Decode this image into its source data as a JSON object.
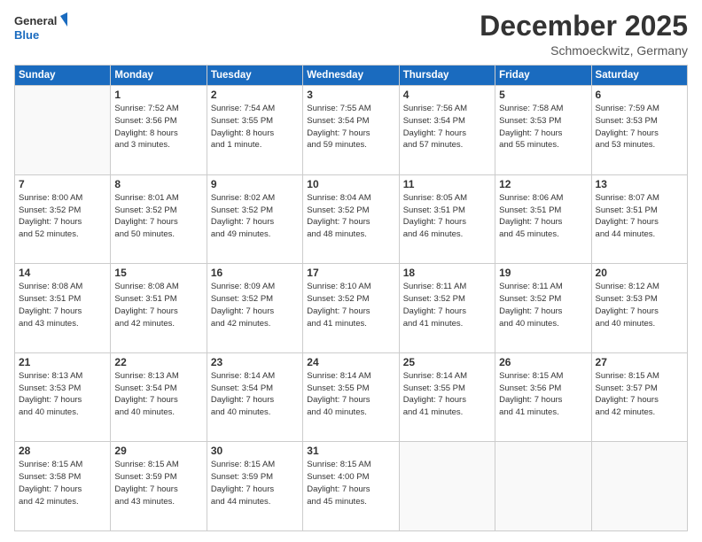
{
  "logo": {
    "line1": "General",
    "line2": "Blue"
  },
  "title": "December 2025",
  "location": "Schmoeckwitz, Germany",
  "days_of_week": [
    "Sunday",
    "Monday",
    "Tuesday",
    "Wednesday",
    "Thursday",
    "Friday",
    "Saturday"
  ],
  "weeks": [
    [
      {
        "day": "",
        "info": ""
      },
      {
        "day": "1",
        "info": "Sunrise: 7:52 AM\nSunset: 3:56 PM\nDaylight: 8 hours\nand 3 minutes."
      },
      {
        "day": "2",
        "info": "Sunrise: 7:54 AM\nSunset: 3:55 PM\nDaylight: 8 hours\nand 1 minute."
      },
      {
        "day": "3",
        "info": "Sunrise: 7:55 AM\nSunset: 3:54 PM\nDaylight: 7 hours\nand 59 minutes."
      },
      {
        "day": "4",
        "info": "Sunrise: 7:56 AM\nSunset: 3:54 PM\nDaylight: 7 hours\nand 57 minutes."
      },
      {
        "day": "5",
        "info": "Sunrise: 7:58 AM\nSunset: 3:53 PM\nDaylight: 7 hours\nand 55 minutes."
      },
      {
        "day": "6",
        "info": "Sunrise: 7:59 AM\nSunset: 3:53 PM\nDaylight: 7 hours\nand 53 minutes."
      }
    ],
    [
      {
        "day": "7",
        "info": "Sunrise: 8:00 AM\nSunset: 3:52 PM\nDaylight: 7 hours\nand 52 minutes."
      },
      {
        "day": "8",
        "info": "Sunrise: 8:01 AM\nSunset: 3:52 PM\nDaylight: 7 hours\nand 50 minutes."
      },
      {
        "day": "9",
        "info": "Sunrise: 8:02 AM\nSunset: 3:52 PM\nDaylight: 7 hours\nand 49 minutes."
      },
      {
        "day": "10",
        "info": "Sunrise: 8:04 AM\nSunset: 3:52 PM\nDaylight: 7 hours\nand 48 minutes."
      },
      {
        "day": "11",
        "info": "Sunrise: 8:05 AM\nSunset: 3:51 PM\nDaylight: 7 hours\nand 46 minutes."
      },
      {
        "day": "12",
        "info": "Sunrise: 8:06 AM\nSunset: 3:51 PM\nDaylight: 7 hours\nand 45 minutes."
      },
      {
        "day": "13",
        "info": "Sunrise: 8:07 AM\nSunset: 3:51 PM\nDaylight: 7 hours\nand 44 minutes."
      }
    ],
    [
      {
        "day": "14",
        "info": "Sunrise: 8:08 AM\nSunset: 3:51 PM\nDaylight: 7 hours\nand 43 minutes."
      },
      {
        "day": "15",
        "info": "Sunrise: 8:08 AM\nSunset: 3:51 PM\nDaylight: 7 hours\nand 42 minutes."
      },
      {
        "day": "16",
        "info": "Sunrise: 8:09 AM\nSunset: 3:52 PM\nDaylight: 7 hours\nand 42 minutes."
      },
      {
        "day": "17",
        "info": "Sunrise: 8:10 AM\nSunset: 3:52 PM\nDaylight: 7 hours\nand 41 minutes."
      },
      {
        "day": "18",
        "info": "Sunrise: 8:11 AM\nSunset: 3:52 PM\nDaylight: 7 hours\nand 41 minutes."
      },
      {
        "day": "19",
        "info": "Sunrise: 8:11 AM\nSunset: 3:52 PM\nDaylight: 7 hours\nand 40 minutes."
      },
      {
        "day": "20",
        "info": "Sunrise: 8:12 AM\nSunset: 3:53 PM\nDaylight: 7 hours\nand 40 minutes."
      }
    ],
    [
      {
        "day": "21",
        "info": "Sunrise: 8:13 AM\nSunset: 3:53 PM\nDaylight: 7 hours\nand 40 minutes."
      },
      {
        "day": "22",
        "info": "Sunrise: 8:13 AM\nSunset: 3:54 PM\nDaylight: 7 hours\nand 40 minutes."
      },
      {
        "day": "23",
        "info": "Sunrise: 8:14 AM\nSunset: 3:54 PM\nDaylight: 7 hours\nand 40 minutes."
      },
      {
        "day": "24",
        "info": "Sunrise: 8:14 AM\nSunset: 3:55 PM\nDaylight: 7 hours\nand 40 minutes."
      },
      {
        "day": "25",
        "info": "Sunrise: 8:14 AM\nSunset: 3:55 PM\nDaylight: 7 hours\nand 41 minutes."
      },
      {
        "day": "26",
        "info": "Sunrise: 8:15 AM\nSunset: 3:56 PM\nDaylight: 7 hours\nand 41 minutes."
      },
      {
        "day": "27",
        "info": "Sunrise: 8:15 AM\nSunset: 3:57 PM\nDaylight: 7 hours\nand 42 minutes."
      }
    ],
    [
      {
        "day": "28",
        "info": "Sunrise: 8:15 AM\nSunset: 3:58 PM\nDaylight: 7 hours\nand 42 minutes."
      },
      {
        "day": "29",
        "info": "Sunrise: 8:15 AM\nSunset: 3:59 PM\nDaylight: 7 hours\nand 43 minutes."
      },
      {
        "day": "30",
        "info": "Sunrise: 8:15 AM\nSunset: 3:59 PM\nDaylight: 7 hours\nand 44 minutes."
      },
      {
        "day": "31",
        "info": "Sunrise: 8:15 AM\nSunset: 4:00 PM\nDaylight: 7 hours\nand 45 minutes."
      },
      {
        "day": "",
        "info": ""
      },
      {
        "day": "",
        "info": ""
      },
      {
        "day": "",
        "info": ""
      }
    ]
  ]
}
